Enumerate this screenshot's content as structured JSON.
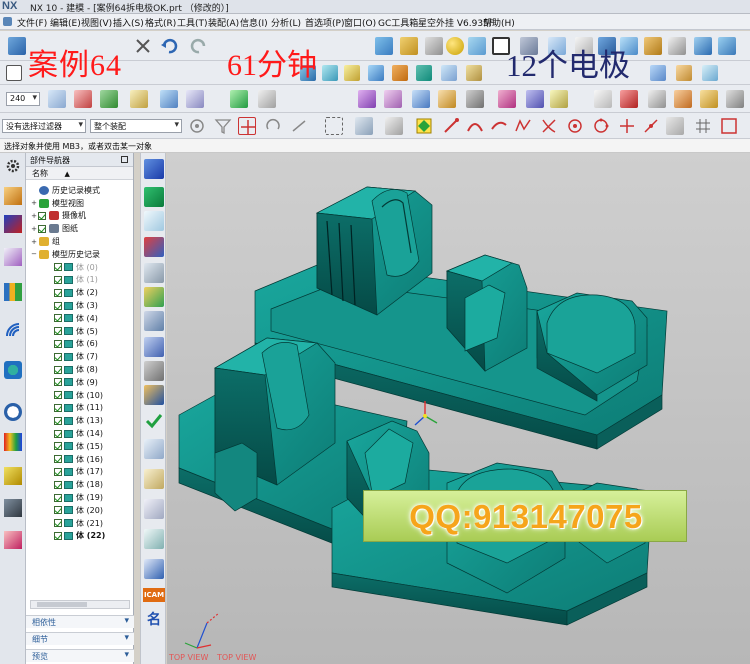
{
  "window": {
    "logo": "NX",
    "title": "NX 10 - 建模 - [案例64拆电极OK.prt （修改的）]"
  },
  "menubar": {
    "items": [
      "文件(F)",
      "编辑(E)",
      "视图(V)",
      "插入(S)",
      "格式(R)",
      "工具(T)",
      "装配(A)",
      "信息(I)",
      "分析(L)",
      "首选项(P)",
      "窗口(O)",
      "GC工具箱",
      "星空外挂 V6.935F",
      "帮助(H)"
    ]
  },
  "overlay": {
    "left_text": "案例64",
    "mid_text": "61分钟",
    "right_text": "12个电极"
  },
  "toolbar": {
    "zoom_value": "240",
    "filter_select": "没有选择过滤器",
    "assembly_select": "整个装配"
  },
  "status": {
    "prompt": "选择对象并使用 MB3，或者双击某一对象"
  },
  "navigator": {
    "title": "部件导航器",
    "column_header": "名称",
    "nodes": [
      {
        "label": "历史记录模式",
        "icon": "clock-icon",
        "indent": 1
      },
      {
        "label": "模型视图",
        "icon": "model-view-icon",
        "indent": 1
      },
      {
        "label": "摄像机",
        "icon": "camera-icon",
        "indent": 1
      },
      {
        "label": "图纸",
        "icon": "drawing-icon",
        "indent": 1
      },
      {
        "label": "组",
        "icon": "folder-icon",
        "indent": 1
      },
      {
        "label": "模型历史记录",
        "icon": "folder-icon",
        "indent": 1
      }
    ],
    "bodies": [
      {
        "label": "体 (0)",
        "style": "dim"
      },
      {
        "label": "体 (1)",
        "style": "dim"
      },
      {
        "label": "体 (2)",
        "style": ""
      },
      {
        "label": "体 (3)",
        "style": ""
      },
      {
        "label": "体 (4)",
        "style": ""
      },
      {
        "label": "体 (5)",
        "style": ""
      },
      {
        "label": "体 (6)",
        "style": ""
      },
      {
        "label": "体 (7)",
        "style": ""
      },
      {
        "label": "体 (8)",
        "style": ""
      },
      {
        "label": "体 (9)",
        "style": ""
      },
      {
        "label": "体 (10)",
        "style": ""
      },
      {
        "label": "体 (11)",
        "style": ""
      },
      {
        "label": "体 (13)",
        "style": ""
      },
      {
        "label": "体 (14)",
        "style": ""
      },
      {
        "label": "体 (15)",
        "style": ""
      },
      {
        "label": "体 (16)",
        "style": ""
      },
      {
        "label": "体 (17)",
        "style": ""
      },
      {
        "label": "体 (18)",
        "style": ""
      },
      {
        "label": "体 (19)",
        "style": ""
      },
      {
        "label": "体 (20)",
        "style": ""
      },
      {
        "label": "体 (21)",
        "style": ""
      },
      {
        "label": "体 (22)",
        "style": "bold"
      }
    ],
    "docked": [
      "相依性",
      "细节",
      "预览"
    ]
  },
  "vtoolbar": {
    "icam_label": "ICAM",
    "name_label": "名"
  },
  "viewport": {
    "view_labels": [
      "TOP VIEW",
      "TOP VIEW"
    ],
    "model_color": "#0f7f78",
    "background": "#c4c4c4"
  },
  "watermark": {
    "text": "QQ:913147075"
  }
}
